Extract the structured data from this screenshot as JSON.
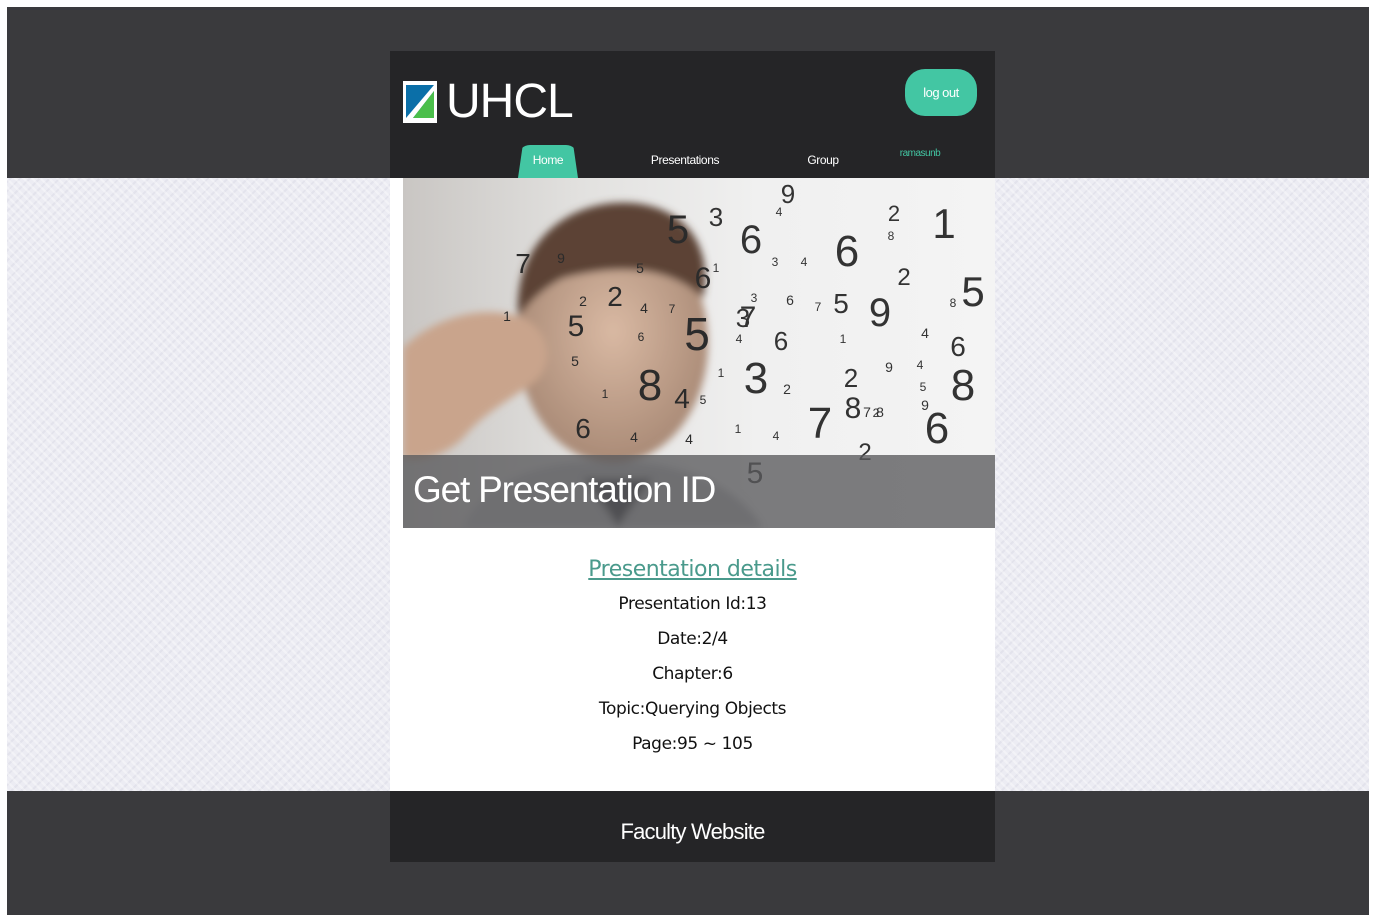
{
  "header": {
    "logo_text": "UHCL",
    "logout_label": "log out",
    "nav": {
      "home": "Home",
      "presentations": "Presentations",
      "group": "Group"
    },
    "username": "ramasunb"
  },
  "hero": {
    "caption": "Get Presentation ID",
    "numbers": [
      "9",
      "4",
      "3",
      "5",
      "6",
      "3",
      "2",
      "8",
      "1",
      "6",
      "4",
      "7",
      "9",
      "5",
      "6",
      "1",
      "2",
      "2",
      "4",
      "7",
      "3",
      "3",
      "6",
      "7",
      "5",
      "9",
      "2",
      "8",
      "5",
      "7",
      "1",
      "5",
      "6",
      "5",
      "4",
      "6",
      "1",
      "4",
      "6",
      "5",
      "1",
      "8",
      "2",
      "9",
      "4",
      "5",
      "8",
      "1",
      "4",
      "5",
      "3",
      "2",
      "8",
      "8",
      "9",
      "6",
      "4",
      "4",
      "1",
      "4",
      "7",
      "2",
      "6",
      "2",
      "7",
      "5"
    ],
    "accent": "#43c6a3"
  },
  "details": {
    "title": "Presentation details",
    "presentation_id": "Presentation Id:13",
    "date": "Date:2/4",
    "chapter": "Chapter:6",
    "topic": "Topic:Querying Objects",
    "page": "Page:95 ~ 105"
  },
  "footer": {
    "text": "Faculty Website"
  }
}
